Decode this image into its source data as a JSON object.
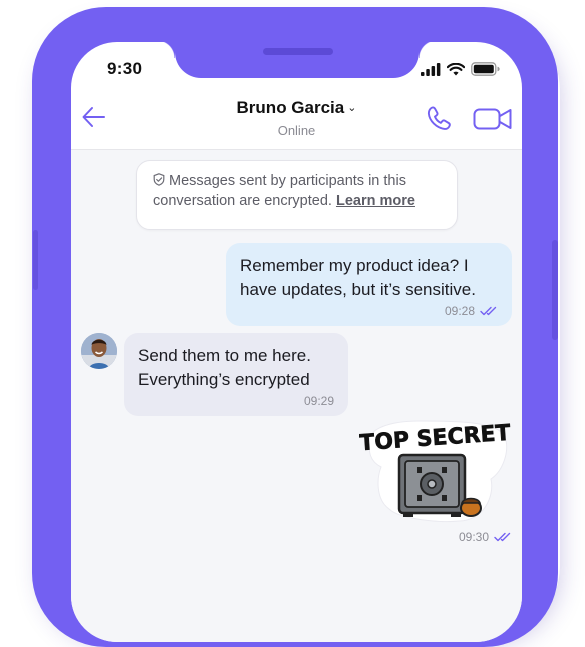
{
  "status_bar": {
    "time": "9:30"
  },
  "header": {
    "contact_name": "Bruno Garcia",
    "presence": "Online"
  },
  "encryption_notice": {
    "text": "Messages sent by participants in this conversation are encrypted.",
    "link": "Learn more"
  },
  "messages": [
    {
      "direction": "outgoing",
      "text": "Remember my product idea? I have updates, but it’s sensitive.",
      "time": "09:28",
      "status": "read"
    },
    {
      "direction": "incoming",
      "text": "Send them to me here. Everything’s encrypted",
      "time": "09:29"
    },
    {
      "direction": "outgoing",
      "type": "sticker",
      "sticker_text": "TOP SECRET",
      "time": "09:30",
      "status": "read"
    }
  ],
  "colors": {
    "brand": "#7360f2",
    "outgoing_bubble": "#dfeefb",
    "incoming_bubble": "#e9eaf3",
    "chat_background": "#f5f6f9"
  },
  "icons": [
    "back-arrow-icon",
    "chevron-down-icon",
    "phone-icon",
    "video-camera-icon",
    "shield-icon",
    "read-check-icon",
    "signal-icon",
    "wifi-icon",
    "battery-icon"
  ]
}
